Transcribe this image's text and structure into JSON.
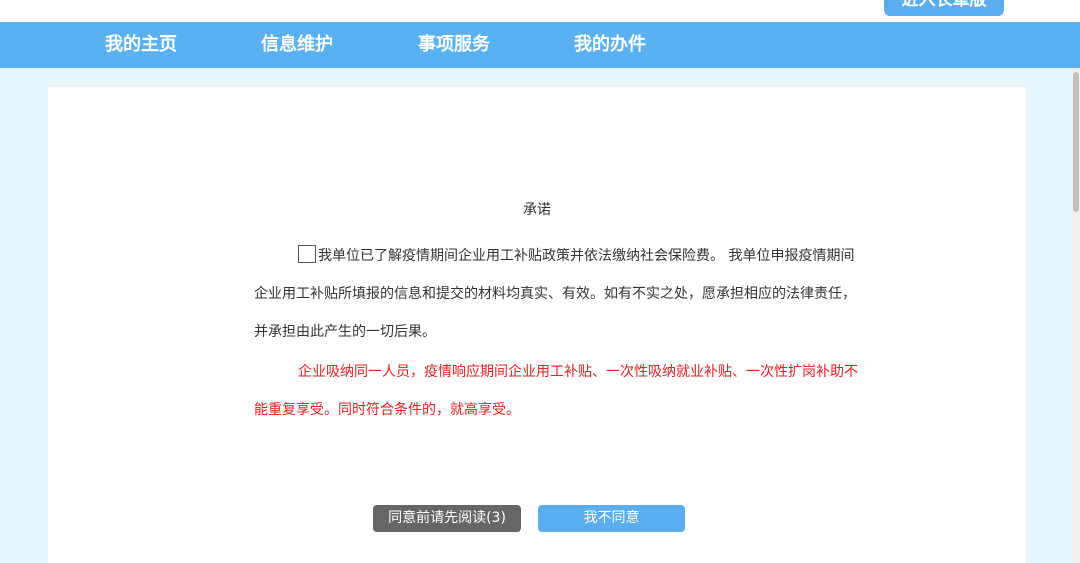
{
  "header": {
    "elder_mode_label": "进入长辈版"
  },
  "nav": {
    "items": [
      {
        "label": "我的主页"
      },
      {
        "label": "信息维护"
      },
      {
        "label": "事项服务"
      },
      {
        "label": "我的办件"
      }
    ]
  },
  "commitment": {
    "title": "承诺",
    "checkbox_checked": false,
    "paragraph1": "我单位已了解疫情期间企业用工补贴政策并依法缴纳社会保险费。 我单位申报疫情期间企业用工补贴所填报的信息和提交的材料均真实、有效。如有不实之处，愿承担相应的法律责任，并承担由此产生的一切后果。",
    "paragraph2": "企业吸纳同一人员，疫情响应期间企业用工补贴、一次性吸纳就业补贴、一次性扩岗补助不能重复享受。同时符合条件的，就高享受。"
  },
  "actions": {
    "read_first_label": "同意前请先阅读(3)",
    "disagree_label": "我不同意"
  },
  "colors": {
    "nav_bg": "#5ab1f2",
    "page_bg": "#e8f6fd",
    "warning_text": "#e62020",
    "read_button_bg": "#666666",
    "disagree_button_bg": "#5aaef0"
  }
}
